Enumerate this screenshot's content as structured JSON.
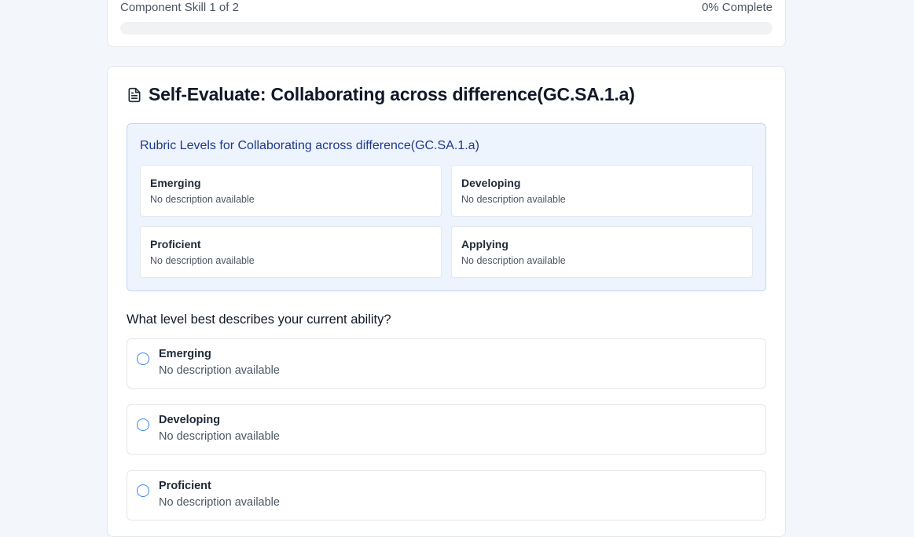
{
  "progress": {
    "label": "Component Skill 1 of 2",
    "percent_text": "0% Complete",
    "value": 0
  },
  "evaluation": {
    "icon": "document-icon",
    "title": "Self-Evaluate: Collaborating across difference(GC.SA.1.a)"
  },
  "rubric": {
    "title": "Rubric Levels for Collaborating across difference(GC.SA.1.a)",
    "levels": [
      {
        "name": "Emerging",
        "description": "No description available"
      },
      {
        "name": "Developing",
        "description": "No description available"
      },
      {
        "name": "Proficient",
        "description": "No description available"
      },
      {
        "name": "Applying",
        "description": "No description available"
      }
    ]
  },
  "question": {
    "text": "What level best describes your current ability?",
    "options": [
      {
        "label": "Emerging",
        "description": "No description available"
      },
      {
        "label": "Developing",
        "description": "No description available"
      },
      {
        "label": "Proficient",
        "description": "No description available"
      }
    ]
  },
  "colors": {
    "accent": "#3b82f6",
    "rubric_bg": "#eef4fd",
    "rubric_title": "#1e3a8a"
  }
}
